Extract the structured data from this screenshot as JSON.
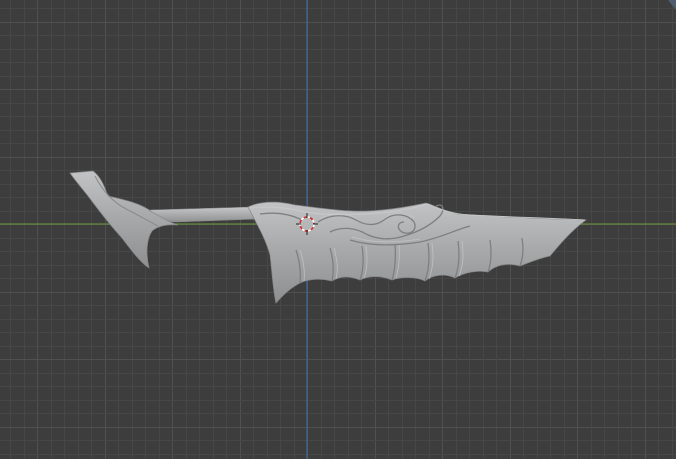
{
  "viewport": {
    "background_color": "#3d3d3d",
    "grid_minor_color": "#474747",
    "grid_major_color": "#505050",
    "axis_x_color": "#6a9a3a",
    "axis_z_color": "#3f6fb0",
    "model_base_color": "#a9aaab",
    "model_shade_color": "#7f8081",
    "model_highlight_color": "#c4c5c6"
  },
  "objects": [
    {
      "name": "sword-mesh",
      "icon": "mesh-icon"
    },
    {
      "name": "3d-cursor",
      "icon": "cursor-3d-icon"
    }
  ]
}
